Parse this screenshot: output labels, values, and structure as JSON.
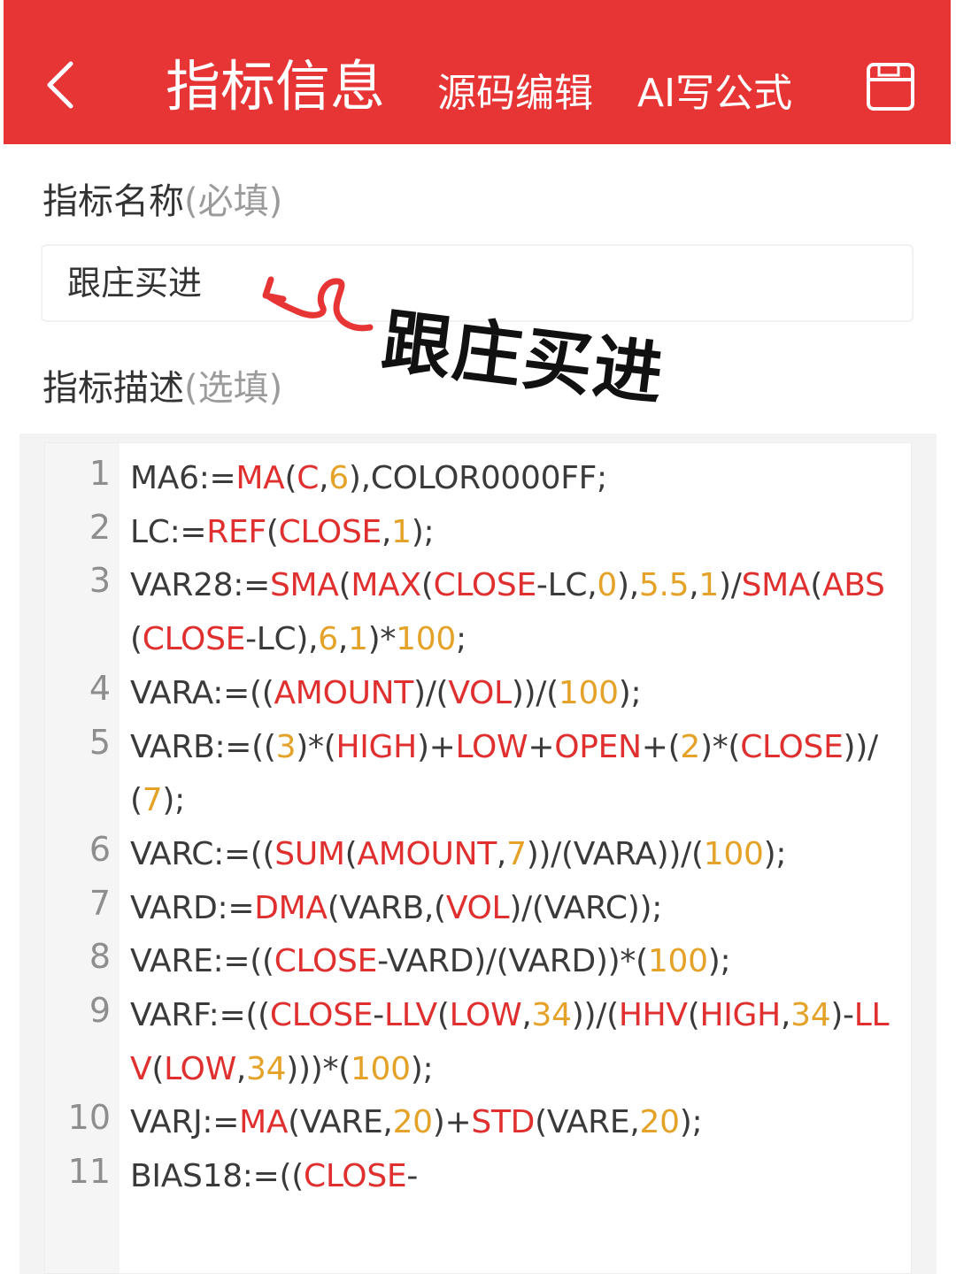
{
  "header": {
    "title": "指标信息",
    "tab_source": "源码编辑",
    "tab_ai": "AI写公式",
    "back_icon": "chevron-left-icon",
    "save_icon": "save-icon",
    "bg_color": "#e73536"
  },
  "form": {
    "name_label": "指标名称",
    "name_hint": "(必填)",
    "name_value": "跟庄买进",
    "desc_label": "指标描述",
    "desc_hint": "(选填)"
  },
  "annotation": {
    "text": "跟庄买进",
    "icon": "curly-arrow-icon",
    "color": "#e73536"
  },
  "editor": {
    "colors": {
      "function": "#e02f2f",
      "number": "#e5a228",
      "text": "#3a3a3a"
    },
    "lines": [
      {
        "num": "1",
        "tokens": [
          [
            "MA6:=",
            "t"
          ],
          [
            "MA",
            "f"
          ],
          [
            "(",
            "t"
          ],
          [
            "C",
            "f"
          ],
          [
            ",",
            "t"
          ],
          [
            "6",
            "n"
          ],
          [
            "),COLOR0000FF;",
            "t"
          ]
        ]
      },
      {
        "num": "2",
        "tokens": [
          [
            "LC:=",
            "t"
          ],
          [
            "REF",
            "f"
          ],
          [
            "(",
            "t"
          ],
          [
            "CLOSE",
            "f"
          ],
          [
            ",",
            "t"
          ],
          [
            "1",
            "n"
          ],
          [
            ");",
            "t"
          ]
        ]
      },
      {
        "num": "3",
        "tokens": [
          [
            "VAR28:=",
            "t"
          ],
          [
            "SMA",
            "f"
          ],
          [
            "(",
            "t"
          ],
          [
            "MAX",
            "f"
          ],
          [
            "(",
            "t"
          ],
          [
            "CLOSE",
            "f"
          ],
          [
            "-LC,",
            "t"
          ],
          [
            "0",
            "n"
          ],
          [
            "),",
            "t"
          ],
          [
            "5.5",
            "n"
          ],
          [
            ",",
            "t"
          ],
          [
            "1",
            "n"
          ],
          [
            ")/",
            "t"
          ],
          [
            "SMA",
            "f"
          ],
          [
            "(",
            "t"
          ],
          [
            "ABS",
            "f"
          ],
          [
            "(",
            "t"
          ],
          [
            "CLOSE",
            "f"
          ],
          [
            "-LC),",
            "t"
          ],
          [
            "6",
            "n"
          ],
          [
            ",",
            "t"
          ],
          [
            "1",
            "n"
          ],
          [
            ")*",
            "t"
          ],
          [
            "100",
            "n"
          ],
          [
            ";",
            "t"
          ]
        ]
      },
      {
        "num": "4",
        "tokens": [
          [
            "VARA:=((",
            "t"
          ],
          [
            "AMOUNT",
            "f"
          ],
          [
            ")/(",
            "t"
          ],
          [
            "VOL",
            "f"
          ],
          [
            "))/(",
            "t"
          ],
          [
            "100",
            "n"
          ],
          [
            ");",
            "t"
          ]
        ]
      },
      {
        "num": "5",
        "tokens": [
          [
            "VARB:=((",
            "t"
          ],
          [
            "3",
            "n"
          ],
          [
            ")*(",
            "t"
          ],
          [
            "HIGH",
            "f"
          ],
          [
            ")+",
            "t"
          ],
          [
            "LOW",
            "f"
          ],
          [
            "+",
            "t"
          ],
          [
            "OPEN",
            "f"
          ],
          [
            "+(",
            "t"
          ],
          [
            "2",
            "n"
          ],
          [
            ")*(",
            "t"
          ],
          [
            "CLOSE",
            "f"
          ],
          [
            "))/(",
            "t"
          ],
          [
            "7",
            "n"
          ],
          [
            ");",
            "t"
          ]
        ]
      },
      {
        "num": "6",
        "tokens": [
          [
            "VARC:=((",
            "t"
          ],
          [
            "SUM",
            "f"
          ],
          [
            "(",
            "t"
          ],
          [
            "AMOUNT",
            "f"
          ],
          [
            ",",
            "t"
          ],
          [
            "7",
            "n"
          ],
          [
            "))/(VARA))/(",
            "t"
          ],
          [
            "100",
            "n"
          ],
          [
            ");",
            "t"
          ]
        ]
      },
      {
        "num": "7",
        "tokens": [
          [
            "VARD:=",
            "t"
          ],
          [
            "DMA",
            "f"
          ],
          [
            "(VARB,(",
            "t"
          ],
          [
            "VOL",
            "f"
          ],
          [
            ")/(VARC));",
            "t"
          ]
        ]
      },
      {
        "num": "8",
        "tokens": [
          [
            "VARE:=((",
            "t"
          ],
          [
            "CLOSE",
            "f"
          ],
          [
            "-VARD)/(VARD))*(",
            "t"
          ],
          [
            "100",
            "n"
          ],
          [
            ");",
            "t"
          ]
        ]
      },
      {
        "num": "9",
        "tokens": [
          [
            "VARF:=((",
            "t"
          ],
          [
            "CLOSE",
            "f"
          ],
          [
            "-",
            "t"
          ],
          [
            "LLV",
            "f"
          ],
          [
            "(",
            "t"
          ],
          [
            "LOW",
            "f"
          ],
          [
            ",",
            "t"
          ],
          [
            "34",
            "n"
          ],
          [
            "))/(",
            "t"
          ],
          [
            "HHV",
            "f"
          ],
          [
            "(",
            "t"
          ],
          [
            "HIGH",
            "f"
          ],
          [
            ",",
            "t"
          ],
          [
            "34",
            "n"
          ],
          [
            ")-",
            "t"
          ],
          [
            "LLV",
            "f"
          ],
          [
            "(",
            "t"
          ],
          [
            "LOW",
            "f"
          ],
          [
            ",",
            "t"
          ],
          [
            "34",
            "n"
          ],
          [
            ")))*(",
            "t"
          ],
          [
            "100",
            "n"
          ],
          [
            ");",
            "t"
          ]
        ]
      },
      {
        "num": "10",
        "tokens": [
          [
            "VARJ:=",
            "t"
          ],
          [
            "MA",
            "f"
          ],
          [
            "(VARE,",
            "t"
          ],
          [
            "20",
            "n"
          ],
          [
            ")+",
            "t"
          ],
          [
            "STD",
            "f"
          ],
          [
            "(VARE,",
            "t"
          ],
          [
            "20",
            "n"
          ],
          [
            ");",
            "t"
          ]
        ]
      },
      {
        "num": "11",
        "tokens": [
          [
            "BIAS18:=((",
            "t"
          ],
          [
            "CLOSE",
            "f"
          ],
          [
            "-",
            "t"
          ]
        ]
      }
    ]
  }
}
